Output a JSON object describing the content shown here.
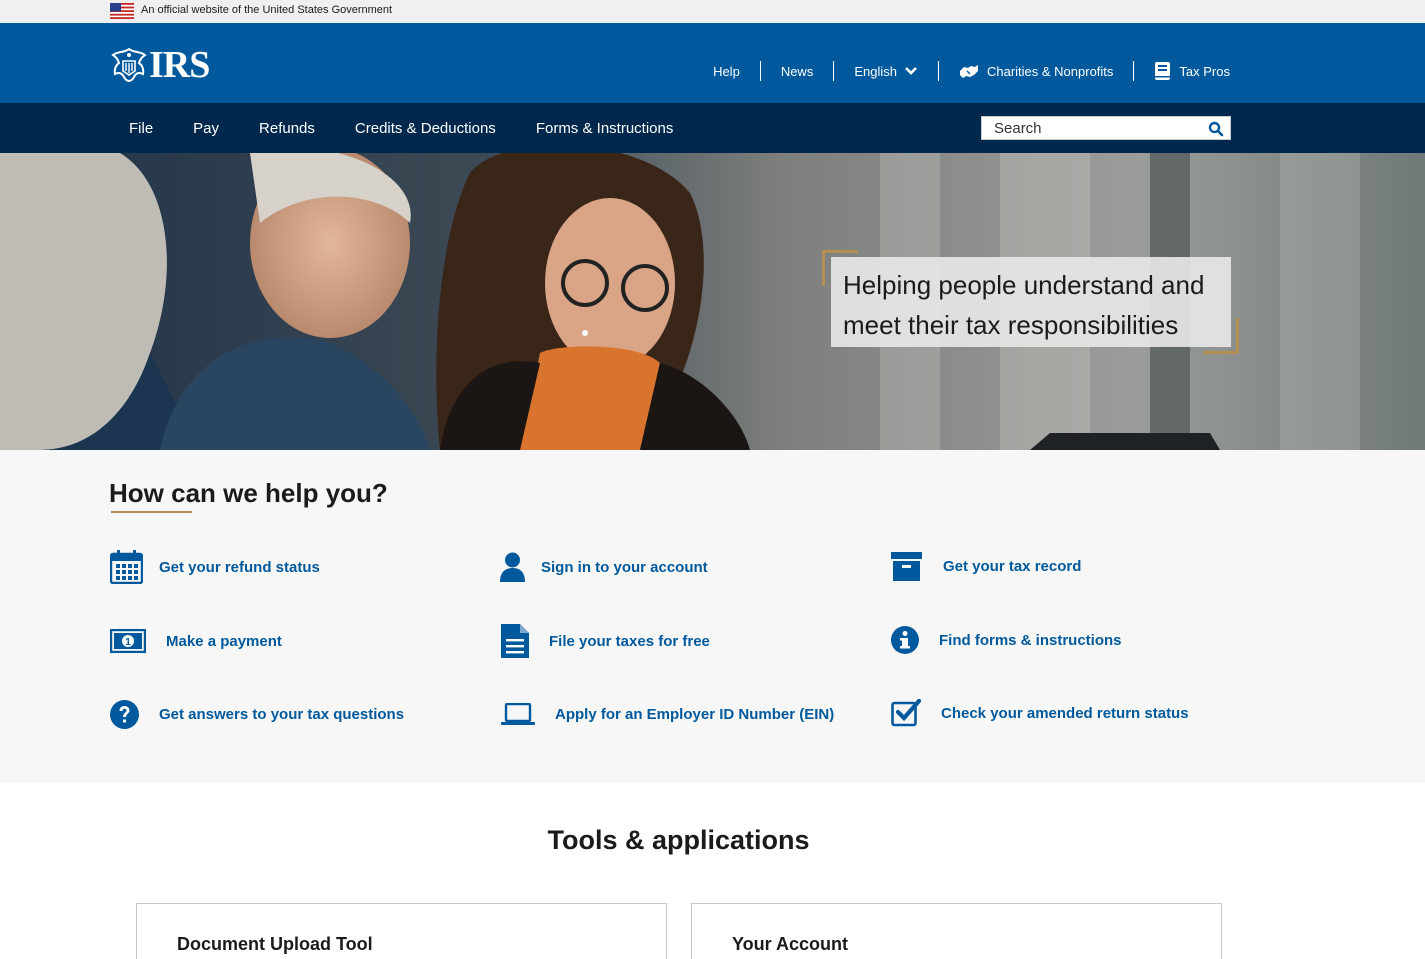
{
  "gov_banner": {
    "text": "An official website of the United States Government"
  },
  "header": {
    "logo_text": "IRS",
    "utility": [
      {
        "label": "Help"
      },
      {
        "label": "News"
      },
      {
        "label": "English"
      },
      {
        "label": "Charities & Nonprofits"
      },
      {
        "label": "Tax Pros"
      }
    ]
  },
  "nav": {
    "items": [
      {
        "label": "File"
      },
      {
        "label": "Pay"
      },
      {
        "label": "Refunds"
      },
      {
        "label": "Credits & Deductions"
      },
      {
        "label": "Forms & Instructions"
      }
    ],
    "search_placeholder": "Search"
  },
  "hero": {
    "tagline_line1": "Helping people understand and",
    "tagline_line2": "meet their tax responsibilities"
  },
  "help": {
    "title": "How can we help you?",
    "links": [
      {
        "label": "Get your refund status",
        "icon": "calendar-icon"
      },
      {
        "label": "Sign in to your account",
        "icon": "user-icon"
      },
      {
        "label": "Get your tax record",
        "icon": "archive-icon"
      },
      {
        "label": "Make a payment",
        "icon": "money-icon"
      },
      {
        "label": "File your taxes for free",
        "icon": "document-icon"
      },
      {
        "label": "Find forms & instructions",
        "icon": "info-icon"
      },
      {
        "label": "Get answers to your tax questions",
        "icon": "question-icon"
      },
      {
        "label": "Apply for an Employer ID Number (EIN)",
        "icon": "laptop-icon"
      },
      {
        "label": "Check your amended return status",
        "icon": "checkbox-icon"
      }
    ]
  },
  "tools": {
    "title": "Tools & applications",
    "cards": [
      {
        "title": "Document Upload Tool"
      },
      {
        "title": "Your Account"
      }
    ]
  },
  "colors": {
    "header_blue": "#00599c",
    "nav_navy": "#00284d",
    "gold_accent": "#b58e53",
    "link_blue": "#00599c"
  }
}
